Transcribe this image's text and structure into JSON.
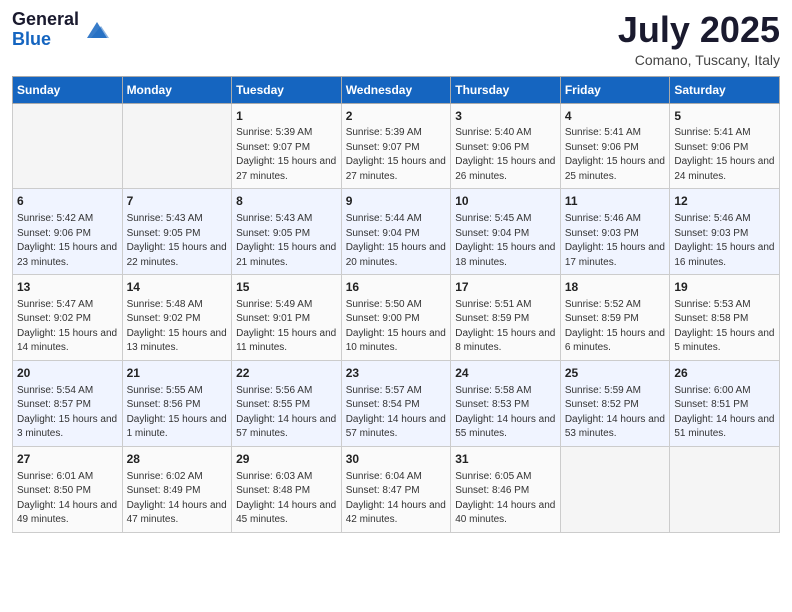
{
  "header": {
    "logo_general": "General",
    "logo_blue": "Blue",
    "month_title": "July 2025",
    "subtitle": "Comano, Tuscany, Italy"
  },
  "days_of_week": [
    "Sunday",
    "Monday",
    "Tuesday",
    "Wednesday",
    "Thursday",
    "Friday",
    "Saturday"
  ],
  "weeks": [
    [
      {
        "day": "",
        "info": ""
      },
      {
        "day": "",
        "info": ""
      },
      {
        "day": "1",
        "info": "Sunrise: 5:39 AM\nSunset: 9:07 PM\nDaylight: 15 hours\nand 27 minutes."
      },
      {
        "day": "2",
        "info": "Sunrise: 5:39 AM\nSunset: 9:07 PM\nDaylight: 15 hours\nand 27 minutes."
      },
      {
        "day": "3",
        "info": "Sunrise: 5:40 AM\nSunset: 9:06 PM\nDaylight: 15 hours\nand 26 minutes."
      },
      {
        "day": "4",
        "info": "Sunrise: 5:41 AM\nSunset: 9:06 PM\nDaylight: 15 hours\nand 25 minutes."
      },
      {
        "day": "5",
        "info": "Sunrise: 5:41 AM\nSunset: 9:06 PM\nDaylight: 15 hours\nand 24 minutes."
      }
    ],
    [
      {
        "day": "6",
        "info": "Sunrise: 5:42 AM\nSunset: 9:06 PM\nDaylight: 15 hours\nand 23 minutes."
      },
      {
        "day": "7",
        "info": "Sunrise: 5:43 AM\nSunset: 9:05 PM\nDaylight: 15 hours\nand 22 minutes."
      },
      {
        "day": "8",
        "info": "Sunrise: 5:43 AM\nSunset: 9:05 PM\nDaylight: 15 hours\nand 21 minutes."
      },
      {
        "day": "9",
        "info": "Sunrise: 5:44 AM\nSunset: 9:04 PM\nDaylight: 15 hours\nand 20 minutes."
      },
      {
        "day": "10",
        "info": "Sunrise: 5:45 AM\nSunset: 9:04 PM\nDaylight: 15 hours\nand 18 minutes."
      },
      {
        "day": "11",
        "info": "Sunrise: 5:46 AM\nSunset: 9:03 PM\nDaylight: 15 hours\nand 17 minutes."
      },
      {
        "day": "12",
        "info": "Sunrise: 5:46 AM\nSunset: 9:03 PM\nDaylight: 15 hours\nand 16 minutes."
      }
    ],
    [
      {
        "day": "13",
        "info": "Sunrise: 5:47 AM\nSunset: 9:02 PM\nDaylight: 15 hours\nand 14 minutes."
      },
      {
        "day": "14",
        "info": "Sunrise: 5:48 AM\nSunset: 9:02 PM\nDaylight: 15 hours\nand 13 minutes."
      },
      {
        "day": "15",
        "info": "Sunrise: 5:49 AM\nSunset: 9:01 PM\nDaylight: 15 hours\nand 11 minutes."
      },
      {
        "day": "16",
        "info": "Sunrise: 5:50 AM\nSunset: 9:00 PM\nDaylight: 15 hours\nand 10 minutes."
      },
      {
        "day": "17",
        "info": "Sunrise: 5:51 AM\nSunset: 8:59 PM\nDaylight: 15 hours\nand 8 minutes."
      },
      {
        "day": "18",
        "info": "Sunrise: 5:52 AM\nSunset: 8:59 PM\nDaylight: 15 hours\nand 6 minutes."
      },
      {
        "day": "19",
        "info": "Sunrise: 5:53 AM\nSunset: 8:58 PM\nDaylight: 15 hours\nand 5 minutes."
      }
    ],
    [
      {
        "day": "20",
        "info": "Sunrise: 5:54 AM\nSunset: 8:57 PM\nDaylight: 15 hours\nand 3 minutes."
      },
      {
        "day": "21",
        "info": "Sunrise: 5:55 AM\nSunset: 8:56 PM\nDaylight: 15 hours\nand 1 minute."
      },
      {
        "day": "22",
        "info": "Sunrise: 5:56 AM\nSunset: 8:55 PM\nDaylight: 14 hours\nand 57 minutes."
      },
      {
        "day": "23",
        "info": "Sunrise: 5:57 AM\nSunset: 8:54 PM\nDaylight: 14 hours\nand 57 minutes."
      },
      {
        "day": "24",
        "info": "Sunrise: 5:58 AM\nSunset: 8:53 PM\nDaylight: 14 hours\nand 55 minutes."
      },
      {
        "day": "25",
        "info": "Sunrise: 5:59 AM\nSunset: 8:52 PM\nDaylight: 14 hours\nand 53 minutes."
      },
      {
        "day": "26",
        "info": "Sunrise: 6:00 AM\nSunset: 8:51 PM\nDaylight: 14 hours\nand 51 minutes."
      }
    ],
    [
      {
        "day": "27",
        "info": "Sunrise: 6:01 AM\nSunset: 8:50 PM\nDaylight: 14 hours\nand 49 minutes."
      },
      {
        "day": "28",
        "info": "Sunrise: 6:02 AM\nSunset: 8:49 PM\nDaylight: 14 hours\nand 47 minutes."
      },
      {
        "day": "29",
        "info": "Sunrise: 6:03 AM\nSunset: 8:48 PM\nDaylight: 14 hours\nand 45 minutes."
      },
      {
        "day": "30",
        "info": "Sunrise: 6:04 AM\nSunset: 8:47 PM\nDaylight: 14 hours\nand 42 minutes."
      },
      {
        "day": "31",
        "info": "Sunrise: 6:05 AM\nSunset: 8:46 PM\nDaylight: 14 hours\nand 40 minutes."
      },
      {
        "day": "",
        "info": ""
      },
      {
        "day": "",
        "info": ""
      }
    ]
  ]
}
